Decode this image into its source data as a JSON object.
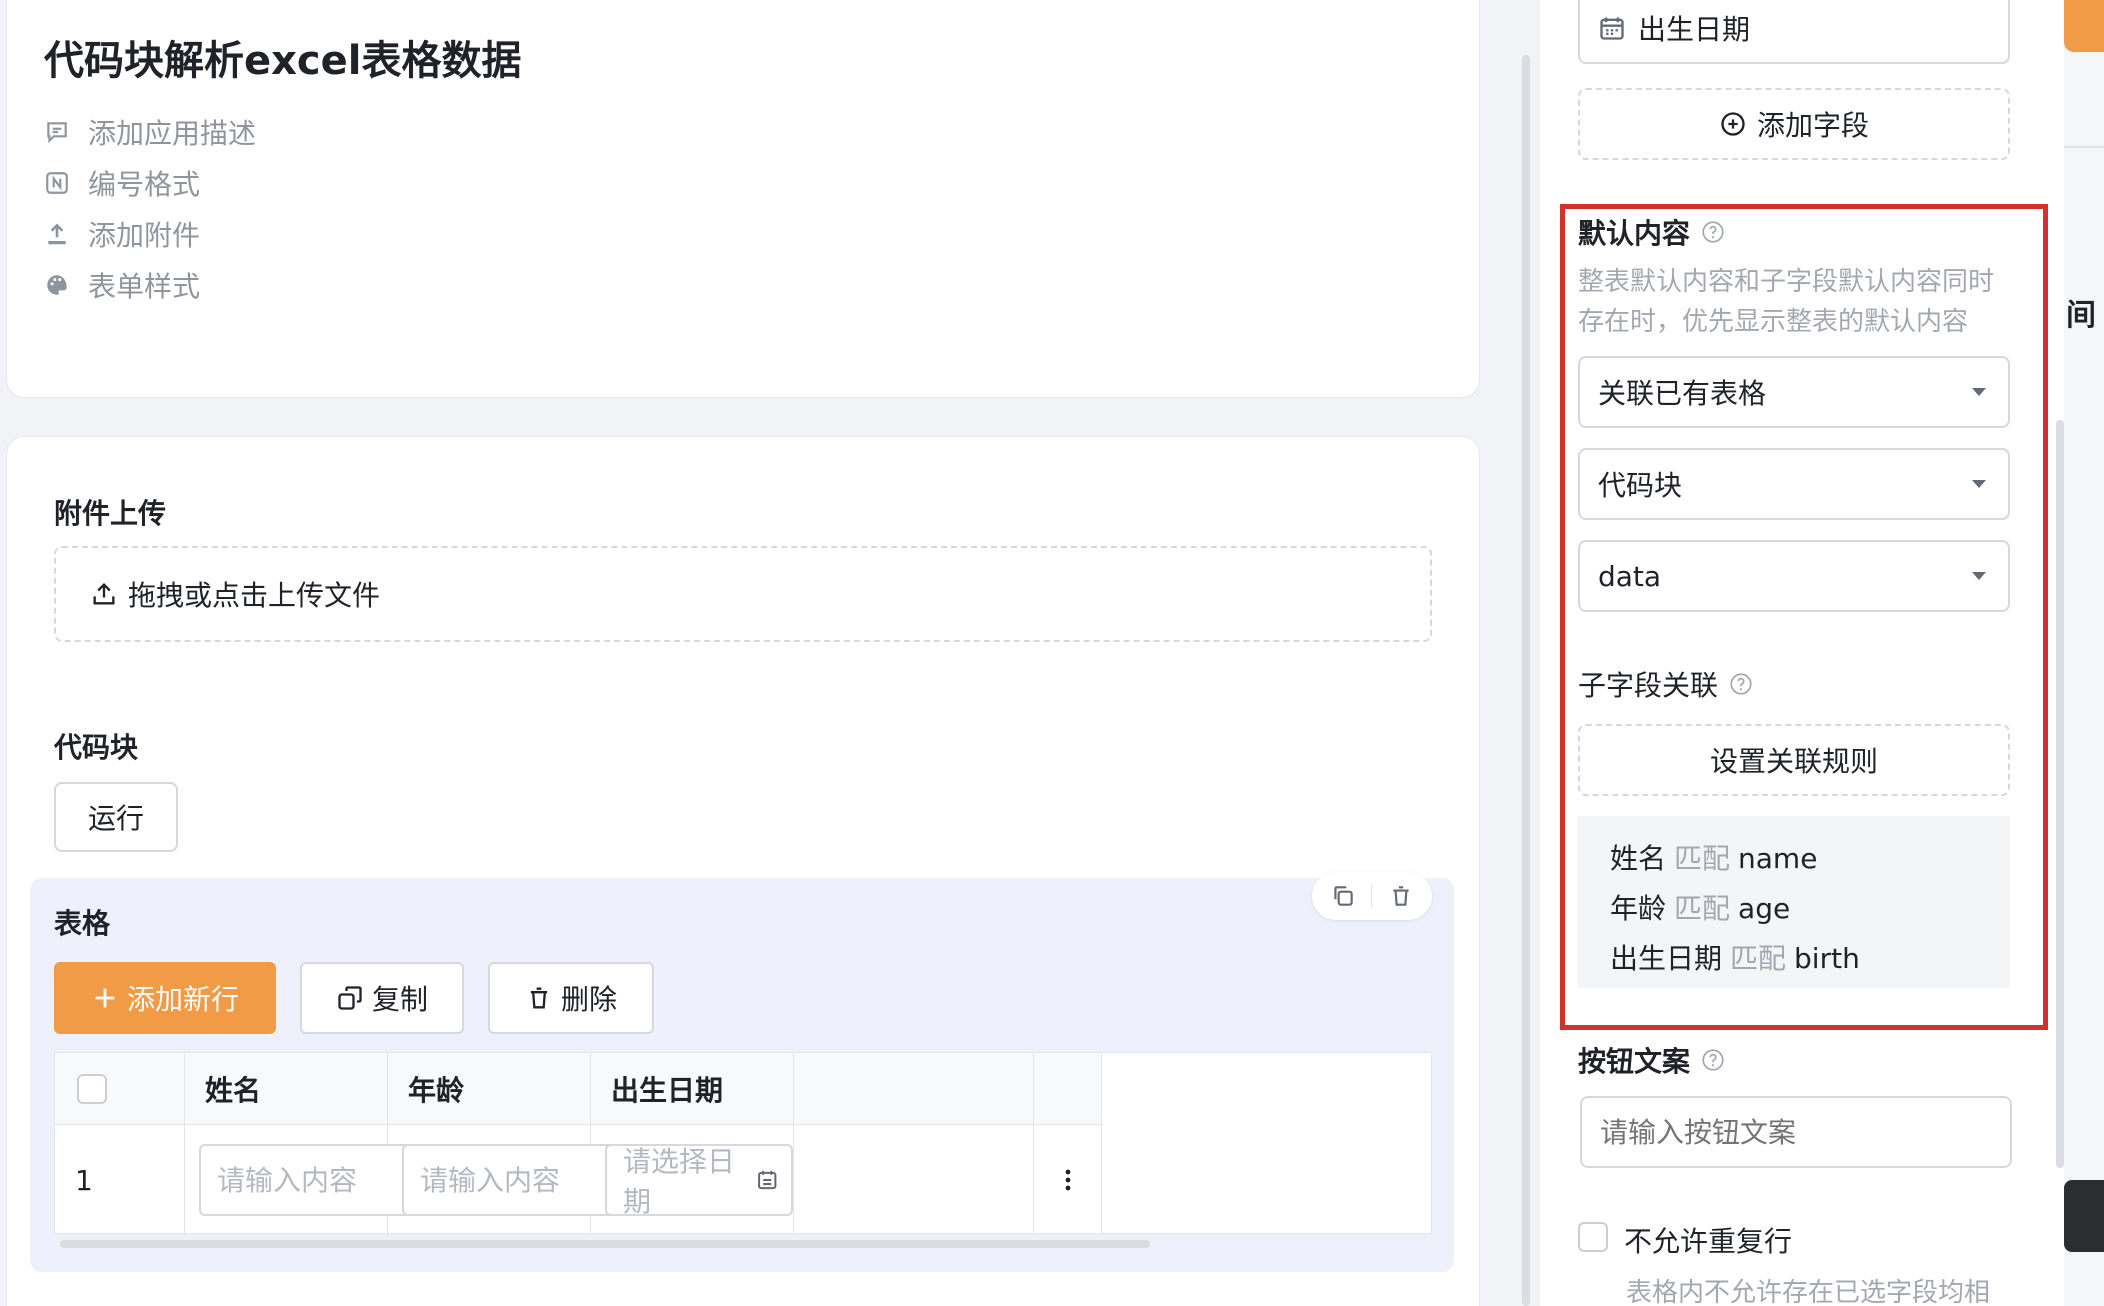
{
  "app": {
    "title": "代码块解析excel表格数据",
    "menu": [
      {
        "label": "添加应用描述",
        "icon": "comment-icon"
      },
      {
        "label": "编号格式",
        "icon": "number-format-icon"
      },
      {
        "label": "添加附件",
        "icon": "upload-icon"
      },
      {
        "label": "表单样式",
        "icon": "palette-icon"
      }
    ]
  },
  "form": {
    "attachment_label": "附件上传",
    "upload_text": "拖拽或点击上传文件",
    "code_label": "代码块",
    "run_label": "运行",
    "table_label": "表格",
    "add_row_label": "添加新行",
    "copy_label": "复制",
    "delete_label": "删除",
    "columns": [
      "姓名",
      "年龄",
      "出生日期"
    ],
    "row": {
      "index": "1",
      "name_placeholder": "请输入内容",
      "age_placeholder": "请输入内容",
      "date_placeholder": "请选择日期"
    }
  },
  "panel": {
    "field_birth": "出生日期",
    "add_field_label": "添加字段",
    "default_content_label": "默认内容",
    "default_content_hint": "整表默认内容和子字段默认内容同时存在时，优先显示整表的默认内容",
    "select_source": "关联已有表格",
    "select_type": "代码块",
    "select_var": "data",
    "sub_field_label": "子字段关联",
    "set_rule_label": "设置关联规则",
    "match_word": "匹配",
    "mappings": [
      {
        "field": "姓名",
        "key": "name"
      },
      {
        "field": "年龄",
        "key": "age"
      },
      {
        "field": "出生日期",
        "key": "birth"
      }
    ],
    "button_text_label": "按钮文案",
    "button_text_placeholder": "请输入按钮文案",
    "no_duplicate_label": "不允许重复行",
    "no_duplicate_hint": "表格内不允许存在已选字段均相"
  },
  "edge": {
    "text": "间"
  },
  "colors": {
    "accent": "#f29b46",
    "highlight": "#d0322c"
  }
}
